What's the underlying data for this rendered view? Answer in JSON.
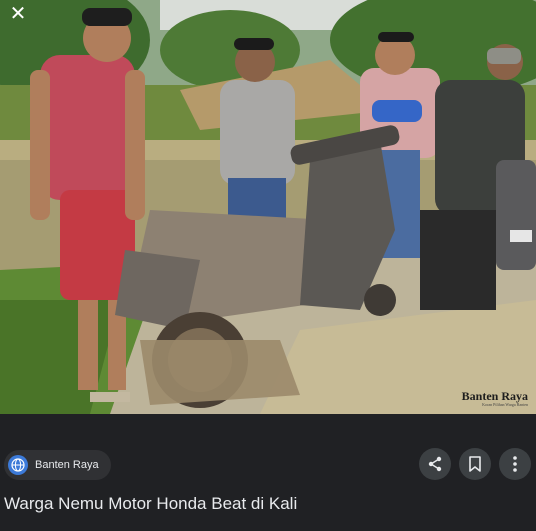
{
  "viewer": {
    "close_icon": "close-icon",
    "close_glyph": "✕"
  },
  "image": {
    "watermark_name": "Banten Raya",
    "watermark_tagline": "Koran Pilihan Warga Banten"
  },
  "source": {
    "name": "Banten Raya",
    "favicon_icon": "globe-icon"
  },
  "actions": {
    "share_icon": "share-icon",
    "bookmark_icon": "bookmark-icon",
    "more_icon": "more-vert-icon"
  },
  "result": {
    "title": "Warga Nemu Motor Honda Beat di Kali"
  },
  "colors": {
    "background": "#202124",
    "chip_background": "#303134",
    "button_background": "#3c4043",
    "text_primary": "#e8eaed",
    "favicon_blue": "#3c7ad8"
  }
}
